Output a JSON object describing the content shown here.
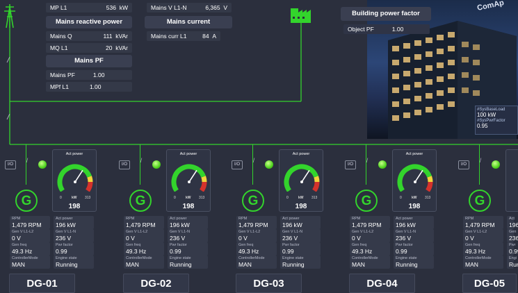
{
  "mains": {
    "mp_l1": {
      "label": "MP L1",
      "value": "536",
      "unit": "kW"
    },
    "mains_reactive_header": "Mains reactive power",
    "mains_q": {
      "label": "Mains Q",
      "value": "111",
      "unit": "kVAr"
    },
    "mq_l1": {
      "label": "MQ L1",
      "value": "20",
      "unit": "kVAr"
    },
    "mains_pf_header": "Mains PF",
    "mains_pf": {
      "label": "Mains PF",
      "value": "1.00"
    },
    "mpf_l1": {
      "label": "MPf L1",
      "value": "1.00"
    },
    "mains_v": {
      "label": "Mains V L1-N",
      "value": "6,365",
      "unit": "V"
    },
    "mains_current_header": "Mains current",
    "mains_curr": {
      "label": "Mains curr L1",
      "value": "84",
      "unit": "A"
    }
  },
  "building": {
    "header": "Building power factor",
    "object_pf": {
      "label": "Object PF",
      "value": "1.00"
    },
    "brand_text": "ComAp",
    "sys_base_load_label": "#SysBaseLoad",
    "sys_base_load_value": "100 kW",
    "sys_pwr_factor_label": "#SysPwrFactor",
    "sys_pwr_factor_value": "0.95"
  },
  "colors": {
    "accent_green": "#33d42c",
    "panel": "#343948",
    "background": "#2b2f3d"
  },
  "gensets": [
    {
      "name": "DG-01",
      "gauge_title": "Act power",
      "gauge_min": "0",
      "gauge_unit": "kW",
      "gauge_max": "313",
      "gauge_value": "198",
      "io": "I/O",
      "rpm_label": "RPM",
      "rpm": "1,479 RPM",
      "act_power_label": "Act power",
      "act_power": "196 kW",
      "gen_v_l1l2_label": "Gen V L1-L2",
      "gen_v_l1l2": "0 V",
      "gen_v_l1n_label": "Gen V L1-N",
      "gen_v_l1n": "236 V",
      "gen_freq_label": "Gen freq",
      "gen_freq": "49.3 Hz",
      "pwr_factor_label": "Pwr factor",
      "pwr_factor": "0.99",
      "mode_label": "ControllerMode",
      "mode": "MAN",
      "engine_label": "Engine state",
      "engine": "Running"
    },
    {
      "name": "DG-02",
      "gauge_title": "Act power",
      "gauge_min": "0",
      "gauge_unit": "kW",
      "gauge_max": "313",
      "gauge_value": "198",
      "io": "I/O",
      "rpm_label": "RPM",
      "rpm": "1,479 RPM",
      "act_power_label": "Act power",
      "act_power": "196 kW",
      "gen_v_l1l2_label": "Gen V L1-L2",
      "gen_v_l1l2": "0 V",
      "gen_v_l1n_label": "Gen V L1-N",
      "gen_v_l1n": "236 V",
      "gen_freq_label": "Gen freq",
      "gen_freq": "49.3 Hz",
      "pwr_factor_label": "Pwr factor",
      "pwr_factor": "0.99",
      "mode_label": "ControllerMode",
      "mode": "MAN",
      "engine_label": "Engine state",
      "engine": "Running"
    },
    {
      "name": "DG-03",
      "gauge_title": "Act power",
      "gauge_min": "0",
      "gauge_unit": "kW",
      "gauge_max": "313",
      "gauge_value": "198",
      "io": "I/O",
      "rpm_label": "RPM",
      "rpm": "1,479 RPM",
      "act_power_label": "Act power",
      "act_power": "196 kW",
      "gen_v_l1l2_label": "Gen V L1-L2",
      "gen_v_l1l2": "0 V",
      "gen_v_l1n_label": "Gen V L1-N",
      "gen_v_l1n": "236 V",
      "gen_freq_label": "Gen freq",
      "gen_freq": "49.3 Hz",
      "pwr_factor_label": "Pwr factor",
      "pwr_factor": "0.99",
      "mode_label": "ControllerMode",
      "mode": "MAN",
      "engine_label": "Engine state",
      "engine": "Running"
    },
    {
      "name": "DG-04",
      "gauge_title": "Act power",
      "gauge_min": "0",
      "gauge_unit": "kW",
      "gauge_max": "313",
      "gauge_value": "198",
      "io": "I/O",
      "rpm_label": "RPM",
      "rpm": "1,479 RPM",
      "act_power_label": "Act power",
      "act_power": "196 kW",
      "gen_v_l1l2_label": "Gen V L1-L2",
      "gen_v_l1l2": "0 V",
      "gen_v_l1n_label": "Gen V L1-N",
      "gen_v_l1n": "236 V",
      "gen_freq_label": "Gen freq",
      "gen_freq": "49.3 Hz",
      "pwr_factor_label": "Pwr factor",
      "pwr_factor": "0.99",
      "mode_label": "ControllerMode",
      "mode": "MAN",
      "engine_label": "Engine state",
      "engine": "Running"
    },
    {
      "name": "DG-05",
      "gauge_title": "",
      "gauge_min": "",
      "gauge_unit": "",
      "gauge_max": "",
      "gauge_value": "",
      "io": "I/O",
      "rpm_label": "RPM",
      "rpm": "1,479 RPM",
      "act_power_label": "Act",
      "act_power": "196",
      "gen_v_l1l2_label": "Gen V L1-L2",
      "gen_v_l1l2": "0 V",
      "gen_v_l1n_label": "Gen",
      "gen_v_l1n": "236",
      "gen_freq_label": "Gen freq",
      "gen_freq": "49.3 Hz",
      "pwr_factor_label": "Pwr",
      "pwr_factor": "0.99",
      "mode_label": "ControllerMode",
      "mode": "MAN",
      "engine_label": "Engi",
      "engine": "Run"
    }
  ]
}
